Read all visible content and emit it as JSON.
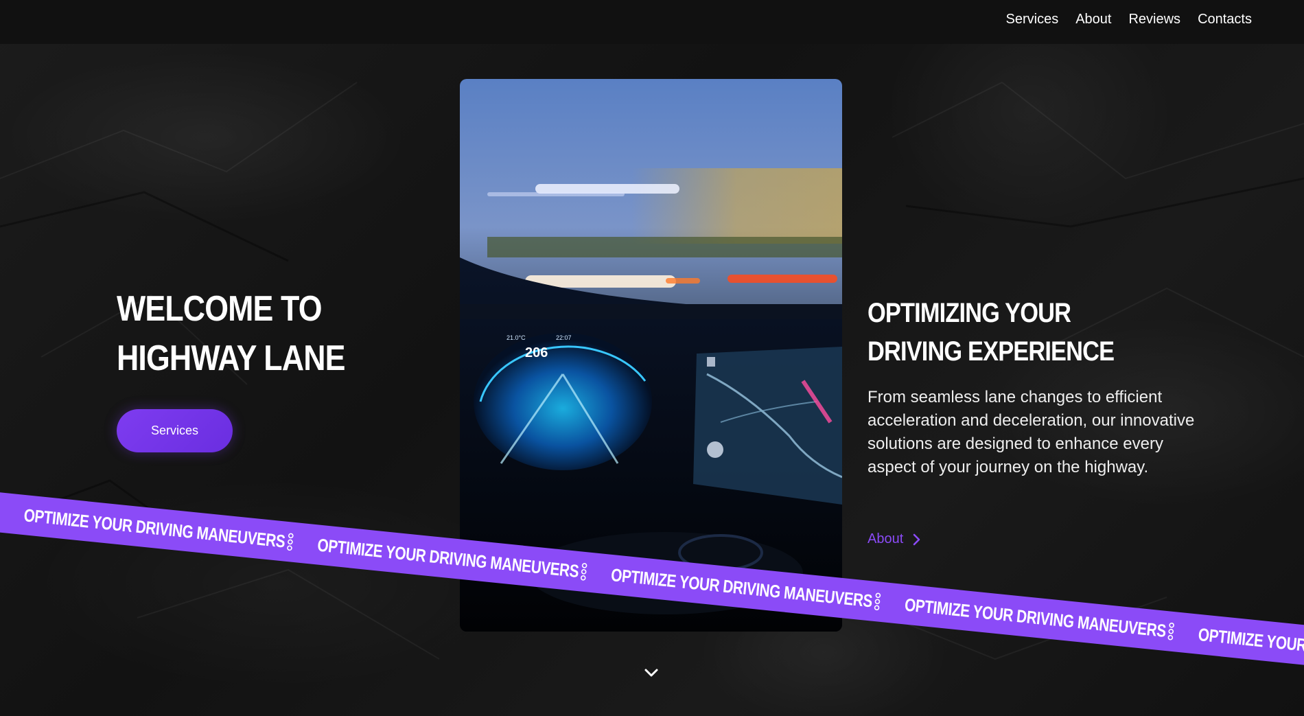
{
  "nav": {
    "items": [
      "Services",
      "About",
      "Reviews",
      "Contacts"
    ]
  },
  "hero": {
    "title": "WELCOME TO HIGHWAY LANE",
    "button_label": "Services"
  },
  "feature": {
    "title": "OPTIMIZING YOUR DRIVING EXPERIENCE",
    "text": "From seamless lane changes to efficient acceleration and deceleration, our innovative solutions are designed to enhance every aspect of your journey on the highway.",
    "link_label": "About"
  },
  "ribbon": {
    "phrase": "OPTIMIZE YOUR DRIVING MANEUVERS"
  },
  "photo": {
    "speed_readout": "206",
    "temp_readout": "21.0°C",
    "time_readout": "22:07"
  },
  "colors": {
    "accent": "#8b4bf7",
    "background": "#151515",
    "header": "#111111"
  },
  "icons": {
    "about_link": "chevron-right-icon",
    "scroll": "chevron-down-icon",
    "ribbon_separator": "dots-icon"
  }
}
